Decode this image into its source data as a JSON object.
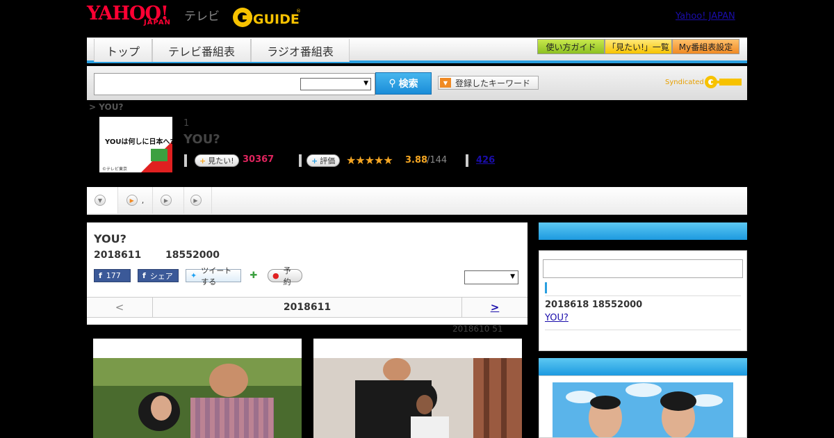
{
  "header": {
    "logo_yahoo": "YAHOO!",
    "logo_japan": "JAPAN",
    "logo_tv": "テレビ",
    "logo_gguide": "GUIDE",
    "yahoo_japan_link": "Yahoo! JAPAN"
  },
  "nav": {
    "tabs": [
      {
        "label": "トップ"
      },
      {
        "label": "テレビ番組表"
      },
      {
        "label": "ラジオ番組表"
      }
    ],
    "guide_buttons": [
      {
        "label": "使い方ガイド"
      },
      {
        "label": "「見たい!」一覧"
      },
      {
        "label": "My番組表設定"
      }
    ]
  },
  "search": {
    "button_label": "検索",
    "keyword_button_label": "登録したキーワード",
    "syndicated_label": "Syndicated"
  },
  "program": {
    "breadcrumb": "> YOU?",
    "episode": "1",
    "title": "YOU?",
    "want_label": "見たい!",
    "want_count": "30367",
    "rate_label": "評価",
    "stars": "★★★★★",
    "rating": "3.88",
    "rating_count": "/144",
    "review_count": "426"
  },
  "subtabs": [
    {
      "label": ""
    },
    {
      "label": ","
    },
    {
      "label": ""
    },
    {
      "label": ""
    }
  ],
  "main": {
    "title": "YOU?",
    "date": "2018611",
    "time": "18552000",
    "fb_like_count": "177",
    "fb_share_label": "シェア",
    "tweet_label": "ツイートする",
    "reserve_label": "予約",
    "pager_prev": "<",
    "pager_date": "2018611",
    "pager_next": ">",
    "updated": "2018610  51"
  },
  "side": {
    "next_date": "2018618  18552000",
    "next_link": "YOU?"
  },
  "colors": {
    "accent_blue": "#2a9fe0",
    "brand_red": "#ff0033",
    "star": "#f5a623",
    "want": "#e0245e"
  }
}
